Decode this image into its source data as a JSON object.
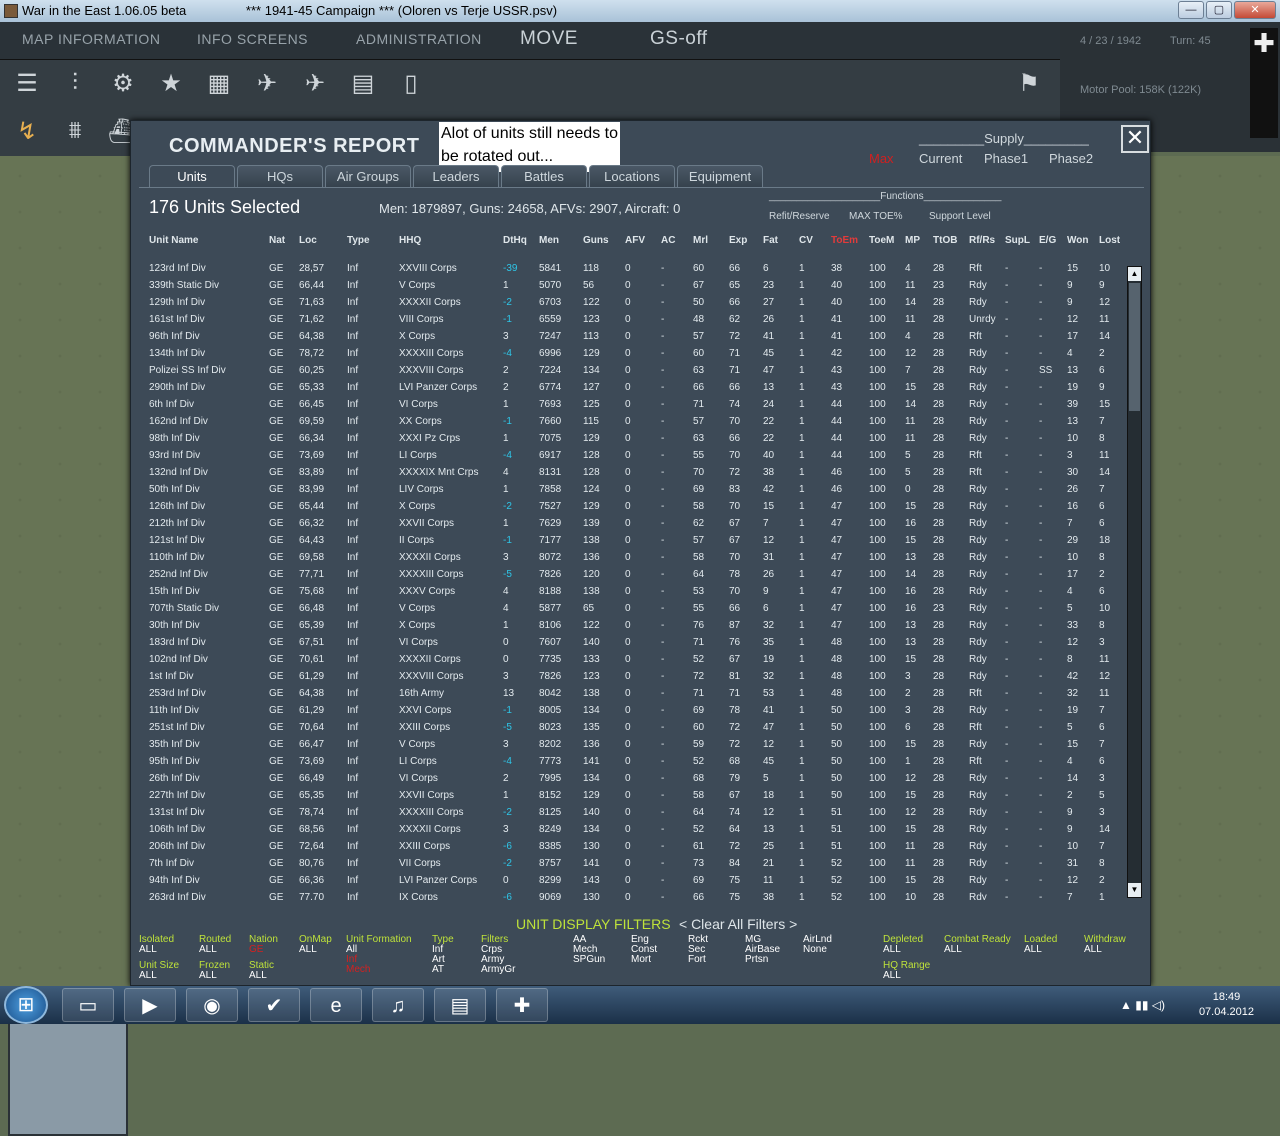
{
  "window": {
    "title": "War in the East 1.06.05 beta",
    "subtitle": "***   1941-45 Campaign   ***   (Oloren vs Terje USSR.psv)",
    "min": "—",
    "max": "▢",
    "close": "✕"
  },
  "topmenu": [
    "MAP INFORMATION",
    "INFO SCREENS",
    "ADMINISTRATION",
    "MOVE",
    "GS-off"
  ],
  "status": {
    "date": "4 / 23 / 1942",
    "turn": "Turn: 45",
    "motor_pool": "Motor Pool:  158K (122K)"
  },
  "dialog": {
    "title": "COMMANDER'S REPORT",
    "note": "Alot of units still needs to be rotated out...",
    "supply_header": "_________Supply_________",
    "supply_cols": [
      "Max",
      "Current",
      "Phase1",
      "Phase2"
    ],
    "tabs": [
      "Units",
      "HQs",
      "Air Groups",
      "Leaders",
      "Battles",
      "Locations",
      "Equipment"
    ],
    "selected": "176 Units Selected",
    "stats": "Men: 1879897, Guns: 24658, AFVs: 2907, Aircraft: 0",
    "functions_header": "____________________Functions______________",
    "functions": [
      "Refit/Reserve",
      "MAX TOE%",
      "Support Level"
    ],
    "columns": [
      "Unit Name",
      "Nat",
      "Loc",
      "Type",
      "HHQ",
      "DtHq",
      "Men",
      "Guns",
      "AFV",
      "AC",
      "Mrl",
      "Exp",
      "Fat",
      "CV",
      "ToEm",
      "ToeM",
      "MP",
      "TtOB",
      "Rf/Rs",
      "SupL",
      "E/G",
      "Won",
      "Lost"
    ],
    "rows": [
      [
        "123rd Inf Div",
        "GE",
        "28,57",
        "Inf",
        "XXVIII Corps",
        "-39",
        "5841",
        "118",
        "0",
        "-",
        "60",
        "66",
        "6",
        "1",
        "38",
        "100",
        "4",
        "28",
        "Rft",
        "-",
        "-",
        "15",
        "10"
      ],
      [
        "339th Static Div",
        "GE",
        "66,44",
        "Inf",
        "V Corps",
        "1",
        "5070",
        "56",
        "0",
        "-",
        "67",
        "65",
        "23",
        "1",
        "40",
        "100",
        "11",
        "23",
        "Rdy",
        "-",
        "-",
        "9",
        "9"
      ],
      [
        "129th Inf Div",
        "GE",
        "71,63",
        "Inf",
        "XXXXII Corps",
        "-2",
        "6703",
        "122",
        "0",
        "-",
        "50",
        "66",
        "27",
        "1",
        "40",
        "100",
        "14",
        "28",
        "Rdy",
        "-",
        "-",
        "9",
        "12"
      ],
      [
        "161st Inf Div",
        "GE",
        "71,62",
        "Inf",
        "VIII Corps",
        "-1",
        "6559",
        "123",
        "0",
        "-",
        "48",
        "62",
        "26",
        "1",
        "41",
        "100",
        "11",
        "28",
        "Unrdy",
        "-",
        "-",
        "12",
        "11"
      ],
      [
        "96th Inf Div",
        "GE",
        "64,38",
        "Inf",
        "X Corps",
        "3",
        "7247",
        "113",
        "0",
        "-",
        "57",
        "72",
        "41",
        "1",
        "41",
        "100",
        "4",
        "28",
        "Rft",
        "-",
        "-",
        "17",
        "14"
      ],
      [
        "134th Inf Div",
        "GE",
        "78,72",
        "Inf",
        "XXXXIII Corps",
        "-4",
        "6996",
        "129",
        "0",
        "-",
        "60",
        "71",
        "45",
        "1",
        "42",
        "100",
        "12",
        "28",
        "Rdy",
        "-",
        "-",
        "4",
        "2"
      ],
      [
        "Polizei SS Inf Div",
        "GE",
        "60,25",
        "Inf",
        "XXXVIII Corps",
        "2",
        "7224",
        "134",
        "0",
        "-",
        "63",
        "71",
        "47",
        "1",
        "43",
        "100",
        "7",
        "28",
        "Rdy",
        "-",
        "SS",
        "13",
        "6"
      ],
      [
        "290th Inf Div",
        "GE",
        "65,33",
        "Inf",
        "LVI Panzer Corps",
        "2",
        "6774",
        "127",
        "0",
        "-",
        "66",
        "66",
        "13",
        "1",
        "43",
        "100",
        "15",
        "28",
        "Rdy",
        "-",
        "-",
        "19",
        "9"
      ],
      [
        "6th Inf Div",
        "GE",
        "66,45",
        "Inf",
        "VI Corps",
        "1",
        "7693",
        "125",
        "0",
        "-",
        "71",
        "74",
        "24",
        "1",
        "44",
        "100",
        "14",
        "28",
        "Rdy",
        "-",
        "-",
        "39",
        "15"
      ],
      [
        "162nd Inf Div",
        "GE",
        "69,59",
        "Inf",
        "XX Corps",
        "-1",
        "7660",
        "115",
        "0",
        "-",
        "57",
        "70",
        "22",
        "1",
        "44",
        "100",
        "11",
        "28",
        "Rdy",
        "-",
        "-",
        "13",
        "7"
      ],
      [
        "98th Inf Div",
        "GE",
        "66,34",
        "Inf",
        "XXXI Pz Crps",
        "1",
        "7075",
        "129",
        "0",
        "-",
        "63",
        "66",
        "22",
        "1",
        "44",
        "100",
        "11",
        "28",
        "Rdy",
        "-",
        "-",
        "10",
        "8"
      ],
      [
        "93rd Inf Div",
        "GE",
        "73,69",
        "Inf",
        "LI Corps",
        "-4",
        "6917",
        "128",
        "0",
        "-",
        "55",
        "70",
        "40",
        "1",
        "44",
        "100",
        "5",
        "28",
        "Rft",
        "-",
        "-",
        "3",
        "11"
      ],
      [
        "132nd Inf Div",
        "GE",
        "83,89",
        "Inf",
        "XXXXIX Mnt Crps",
        "4",
        "8131",
        "128",
        "0",
        "-",
        "70",
        "72",
        "38",
        "1",
        "46",
        "100",
        "5",
        "28",
        "Rft",
        "-",
        "-",
        "30",
        "14"
      ],
      [
        "50th Inf Div",
        "GE",
        "83,99",
        "Inf",
        "LIV Corps",
        "1",
        "7858",
        "124",
        "0",
        "-",
        "69",
        "83",
        "42",
        "1",
        "46",
        "100",
        "0",
        "28",
        "Rdy",
        "-",
        "-",
        "26",
        "7"
      ],
      [
        "126th Inf Div",
        "GE",
        "65,44",
        "Inf",
        "X Corps",
        "-2",
        "7527",
        "129",
        "0",
        "-",
        "58",
        "70",
        "15",
        "1",
        "47",
        "100",
        "15",
        "28",
        "Rdy",
        "-",
        "-",
        "16",
        "6"
      ],
      [
        "212th Inf Div",
        "GE",
        "66,32",
        "Inf",
        "XXVII Corps",
        "1",
        "7629",
        "139",
        "0",
        "-",
        "62",
        "67",
        "7",
        "1",
        "47",
        "100",
        "16",
        "28",
        "Rdy",
        "-",
        "-",
        "7",
        "6"
      ],
      [
        "121st Inf Div",
        "GE",
        "64,43",
        "Inf",
        "II Corps",
        "-1",
        "7177",
        "138",
        "0",
        "-",
        "57",
        "67",
        "12",
        "1",
        "47",
        "100",
        "15",
        "28",
        "Rdy",
        "-",
        "-",
        "29",
        "18"
      ],
      [
        "110th Inf Div",
        "GE",
        "69,58",
        "Inf",
        "XXXXII Corps",
        "3",
        "8072",
        "136",
        "0",
        "-",
        "58",
        "70",
        "31",
        "1",
        "47",
        "100",
        "13",
        "28",
        "Rdy",
        "-",
        "-",
        "10",
        "8"
      ],
      [
        "252nd Inf Div",
        "GE",
        "77,71",
        "Inf",
        "XXXXIII Corps",
        "-5",
        "7826",
        "120",
        "0",
        "-",
        "64",
        "78",
        "26",
        "1",
        "47",
        "100",
        "14",
        "28",
        "Rdy",
        "-",
        "-",
        "17",
        "2"
      ],
      [
        "15th Inf Div",
        "GE",
        "75,68",
        "Inf",
        "XXXV Corps",
        "4",
        "8188",
        "138",
        "0",
        "-",
        "53",
        "70",
        "9",
        "1",
        "47",
        "100",
        "16",
        "28",
        "Rdy",
        "-",
        "-",
        "4",
        "6"
      ],
      [
        "707th Static Div",
        "GE",
        "66,48",
        "Inf",
        "V Corps",
        "4",
        "5877",
        "65",
        "0",
        "-",
        "55",
        "66",
        "6",
        "1",
        "47",
        "100",
        "16",
        "23",
        "Rdy",
        "-",
        "-",
        "5",
        "10"
      ],
      [
        "30th Inf Div",
        "GE",
        "65,39",
        "Inf",
        "X Corps",
        "1",
        "8106",
        "122",
        "0",
        "-",
        "76",
        "87",
        "32",
        "1",
        "47",
        "100",
        "13",
        "28",
        "Rdy",
        "-",
        "-",
        "33",
        "8"
      ],
      [
        "183rd Inf Div",
        "GE",
        "67,51",
        "Inf",
        "VI Corps",
        "0",
        "7607",
        "140",
        "0",
        "-",
        "71",
        "76",
        "35",
        "1",
        "48",
        "100",
        "13",
        "28",
        "Rdy",
        "-",
        "-",
        "12",
        "3"
      ],
      [
        "102nd Inf Div",
        "GE",
        "70,61",
        "Inf",
        "XXXXII Corps",
        "0",
        "7735",
        "133",
        "0",
        "-",
        "52",
        "67",
        "19",
        "1",
        "48",
        "100",
        "15",
        "28",
        "Rdy",
        "-",
        "-",
        "8",
        "11"
      ],
      [
        "1st Inf Div",
        "GE",
        "61,29",
        "Inf",
        "XXXVIII Corps",
        "3",
        "7826",
        "123",
        "0",
        "-",
        "72",
        "81",
        "32",
        "1",
        "48",
        "100",
        "3",
        "28",
        "Rdy",
        "-",
        "-",
        "42",
        "12"
      ],
      [
        "253rd Inf Div",
        "GE",
        "64,38",
        "Inf",
        "16th Army",
        "13",
        "8042",
        "138",
        "0",
        "-",
        "71",
        "71",
        "53",
        "1",
        "48",
        "100",
        "2",
        "28",
        "Rft",
        "-",
        "-",
        "32",
        "11"
      ],
      [
        "11th Inf Div",
        "GE",
        "61,29",
        "Inf",
        "XXVI Corps",
        "-1",
        "8005",
        "134",
        "0",
        "-",
        "69",
        "78",
        "41",
        "1",
        "50",
        "100",
        "3",
        "28",
        "Rdy",
        "-",
        "-",
        "19",
        "7"
      ],
      [
        "251st Inf Div",
        "GE",
        "70,64",
        "Inf",
        "XXIII Corps",
        "-5",
        "8023",
        "135",
        "0",
        "-",
        "60",
        "72",
        "47",
        "1",
        "50",
        "100",
        "6",
        "28",
        "Rft",
        "-",
        "-",
        "5",
        "6"
      ],
      [
        "35th Inf Div",
        "GE",
        "66,47",
        "Inf",
        "V Corps",
        "3",
        "8202",
        "136",
        "0",
        "-",
        "59",
        "72",
        "12",
        "1",
        "50",
        "100",
        "15",
        "28",
        "Rdy",
        "-",
        "-",
        "15",
        "7"
      ],
      [
        "95th Inf Div",
        "GE",
        "73,69",
        "Inf",
        "LI Corps",
        "-4",
        "7773",
        "141",
        "0",
        "-",
        "52",
        "68",
        "45",
        "1",
        "50",
        "100",
        "1",
        "28",
        "Rft",
        "-",
        "-",
        "4",
        "6"
      ],
      [
        "26th Inf Div",
        "GE",
        "66,49",
        "Inf",
        "VI Corps",
        "2",
        "7995",
        "134",
        "0",
        "-",
        "68",
        "79",
        "5",
        "1",
        "50",
        "100",
        "12",
        "28",
        "Rdy",
        "-",
        "-",
        "14",
        "3"
      ],
      [
        "227th Inf Div",
        "GE",
        "65,35",
        "Inf",
        "XXVII Corps",
        "1",
        "8152",
        "129",
        "0",
        "-",
        "58",
        "67",
        "18",
        "1",
        "50",
        "100",
        "15",
        "28",
        "Rdy",
        "-",
        "-",
        "2",
        "5"
      ],
      [
        "131st Inf Div",
        "GE",
        "78,74",
        "Inf",
        "XXXXIII Corps",
        "-2",
        "8125",
        "140",
        "0",
        "-",
        "64",
        "74",
        "12",
        "1",
        "51",
        "100",
        "12",
        "28",
        "Rdy",
        "-",
        "-",
        "9",
        "3"
      ],
      [
        "106th Inf Div",
        "GE",
        "68,56",
        "Inf",
        "XXXXII Corps",
        "3",
        "8249",
        "134",
        "0",
        "-",
        "52",
        "64",
        "13",
        "1",
        "51",
        "100",
        "15",
        "28",
        "Rdy",
        "-",
        "-",
        "9",
        "14"
      ],
      [
        "206th Inf Div",
        "GE",
        "72,64",
        "Inf",
        "XXIII Corps",
        "-6",
        "8385",
        "130",
        "0",
        "-",
        "61",
        "72",
        "25",
        "1",
        "51",
        "100",
        "11",
        "28",
        "Rdy",
        "-",
        "-",
        "10",
        "7"
      ],
      [
        "7th Inf Div",
        "GE",
        "80,76",
        "Inf",
        "VII Corps",
        "-2",
        "8757",
        "141",
        "0",
        "-",
        "73",
        "84",
        "21",
        "1",
        "52",
        "100",
        "11",
        "28",
        "Rdy",
        "-",
        "-",
        "31",
        "8"
      ],
      [
        "94th Inf Div",
        "GE",
        "66,36",
        "Inf",
        "LVI Panzer Corps",
        "0",
        "8299",
        "143",
        "0",
        "-",
        "69",
        "75",
        "11",
        "1",
        "52",
        "100",
        "15",
        "28",
        "Rdy",
        "-",
        "-",
        "12",
        "2"
      ],
      [
        "263rd Inf Div",
        "GE",
        "77,70",
        "Inf",
        "IX Corps",
        "-6",
        "9069",
        "130",
        "0",
        "-",
        "66",
        "75",
        "38",
        "1",
        "52",
        "100",
        "10",
        "28",
        "Rdy",
        "-",
        "-",
        "7",
        "1"
      ]
    ],
    "filters_title": "UNIT DISPLAY FILTERS",
    "clear_filters": "< Clear All Filters >"
  },
  "filters": [
    {
      "h": "Isolated",
      "v": [
        "ALL"
      ]
    },
    {
      "h": "Routed",
      "v": [
        "ALL"
      ]
    },
    {
      "h": "Nation",
      "v": [
        "GE"
      ],
      "red": true
    },
    {
      "h": "OnMap",
      "v": [
        "ALL"
      ]
    },
    {
      "h": "Unit Formation",
      "v": [
        "All",
        "Inf",
        "Mech"
      ],
      "red": true
    },
    {
      "h": "Type",
      "v": [
        "Inf",
        "Art",
        "AT"
      ]
    },
    {
      "h": "Filters",
      "v": [
        "Crps",
        "Army",
        "ArmyGr"
      ]
    },
    {
      "h": "",
      "v": [
        "AA",
        "Mech",
        "SPGun"
      ]
    },
    {
      "h": "",
      "v": [
        "Eng",
        "Const",
        "Mort"
      ]
    },
    {
      "h": "",
      "v": [
        "Rckt",
        "Sec",
        "Fort"
      ]
    },
    {
      "h": "",
      "v": [
        "MG",
        "AirBase",
        "Prtsn"
      ]
    },
    {
      "h": "",
      "v": [
        "AirLnd",
        "None"
      ]
    },
    {
      "h": "Depleted",
      "v": [
        "ALL"
      ]
    },
    {
      "h": "Combat Ready",
      "v": [
        "ALL"
      ]
    },
    {
      "h": "Loaded",
      "v": [
        "ALL"
      ]
    },
    {
      "h": "Withdraw",
      "v": [
        "ALL"
      ]
    },
    {
      "h": "Unit Size",
      "v": [
        "ALL"
      ]
    },
    {
      "h": "Frozen",
      "v": [
        "ALL"
      ]
    },
    {
      "h": "Static",
      "v": [
        "ALL"
      ]
    },
    {
      "h": "HQ Range",
      "v": [
        "ALL"
      ]
    }
  ],
  "taskbar": {
    "time": "18:49",
    "date": "07.04.2012"
  }
}
